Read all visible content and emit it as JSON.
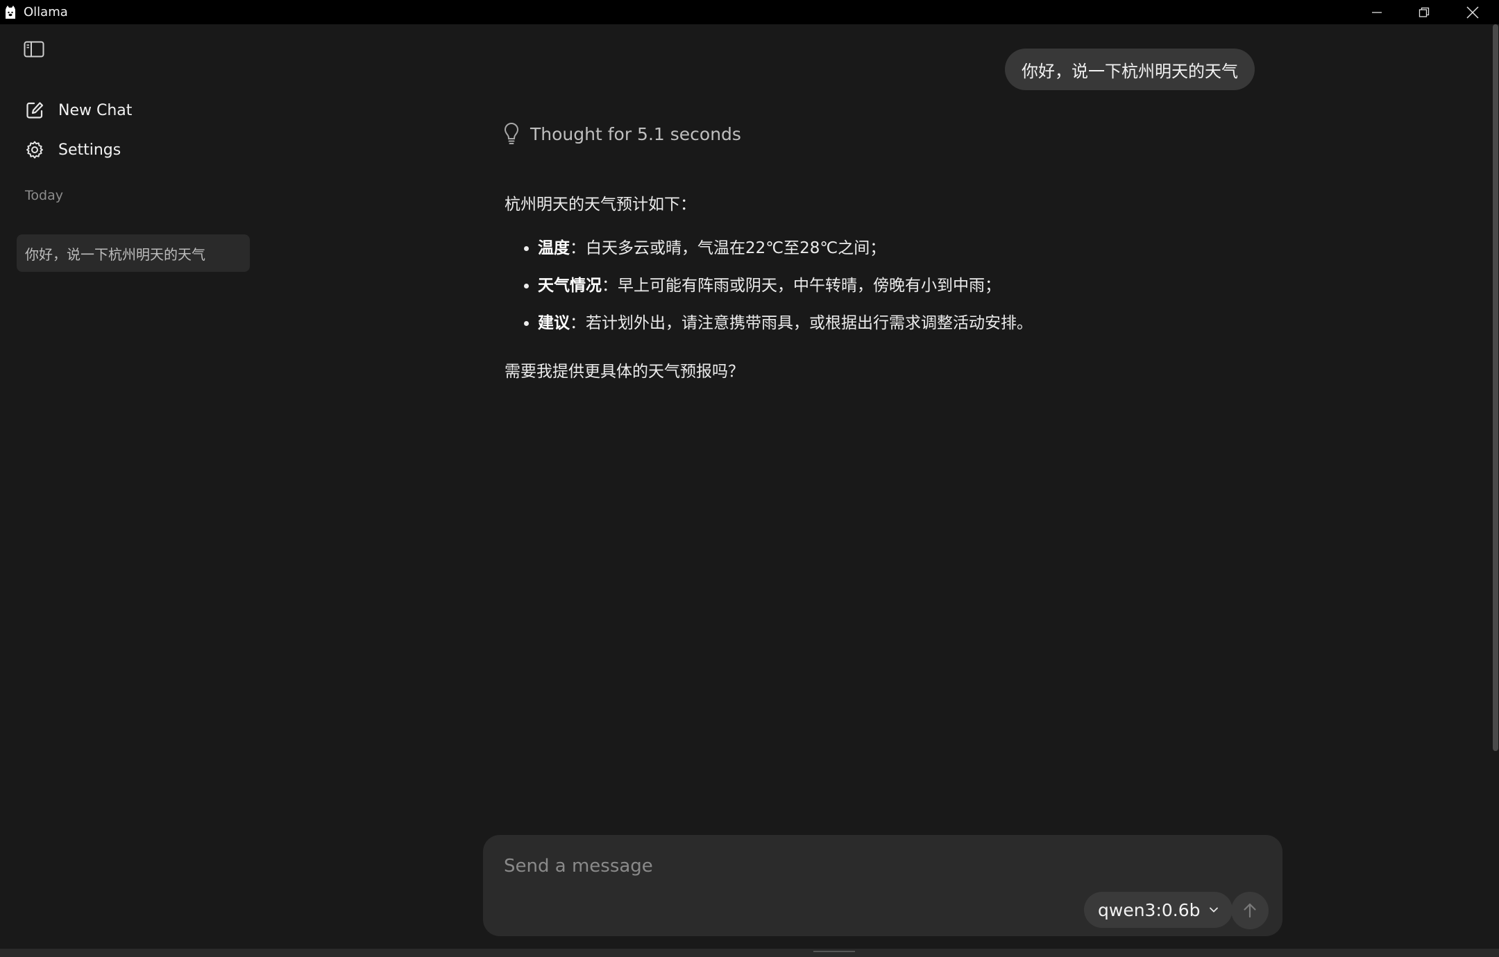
{
  "window": {
    "title": "Ollama"
  },
  "sidebar": {
    "new_chat_label": "New Chat",
    "settings_label": "Settings",
    "section_label": "Today",
    "chats": [
      {
        "title": "你好，说一下杭州明天的天气"
      }
    ]
  },
  "conversation": {
    "user_message": "你好，说一下杭州明天的天气",
    "thought_label": "Thought for 5.1 seconds",
    "answer": {
      "intro": "杭州明天的天气预计如下：",
      "bullets": [
        {
          "label": "温度",
          "text": "：白天多云或晴，气温在22℃至28℃之间；"
        },
        {
          "label": "天气情况",
          "text": "：早上可能有阵雨或阴天，中午转晴，傍晚有小到中雨；"
        },
        {
          "label": "建议",
          "text": "：若计划外出，请注意携带雨具，或根据出行需求调整活动安排。"
        }
      ],
      "closing": "需要我提供更具体的天气预报吗？"
    }
  },
  "composer": {
    "placeholder": "Send a message",
    "value": "",
    "model": "qwen3:0.6b"
  },
  "colors": {
    "background": "#191919",
    "titlebar": "#000000",
    "bubble": "#383838",
    "composer": "#2b2b2b"
  }
}
